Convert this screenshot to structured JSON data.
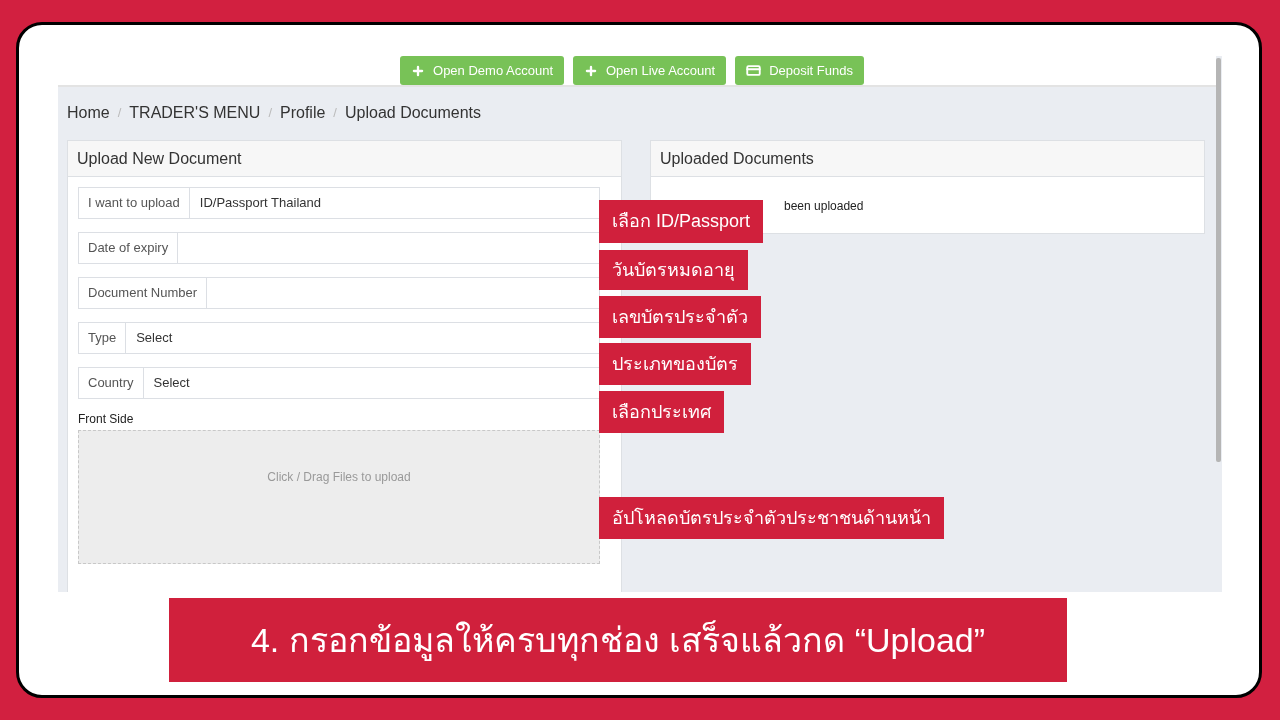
{
  "toolbar": {
    "buttons": [
      {
        "label": "Open Demo Account",
        "kind": "plus"
      },
      {
        "label": "Open Live Account",
        "kind": "plus"
      },
      {
        "label": "Deposit Funds",
        "kind": "card"
      }
    ]
  },
  "breadcrumb": {
    "separator": "/",
    "items": [
      "Home",
      "TRADER'S MENU",
      "Profile",
      "Upload Documents"
    ]
  },
  "upload_panel": {
    "title": "Upload New Document",
    "fields": [
      {
        "label": "I want to upload",
        "value": "ID/Passport Thailand",
        "kind": "select"
      },
      {
        "label": "Date of expiry",
        "kind": "text"
      },
      {
        "label": "Document Number",
        "kind": "text"
      },
      {
        "label": "Type",
        "value": "Select",
        "kind": "select"
      },
      {
        "label": "Country",
        "value": "Select",
        "kind": "select"
      }
    ],
    "front_side": {
      "label": "Front Side",
      "hint": "Click / Drag Files to upload"
    }
  },
  "uploaded_panel": {
    "title": "Uploaded Documents",
    "message": "been uploaded"
  },
  "annotations": [
    "เลือก ID/Passport",
    "วันบัตรหมดอายุ",
    "เลขบัตรประจำตัว",
    "ประเภทของบัตร",
    "เลือกประเทศ",
    "อัปโหลดบัตรประจำตัวประชาชนด้านหน้า"
  ],
  "banner": "4. กรอกข้อมูลให้ครบทุกช่อง เสร็จแล้วกด “Upload”"
}
